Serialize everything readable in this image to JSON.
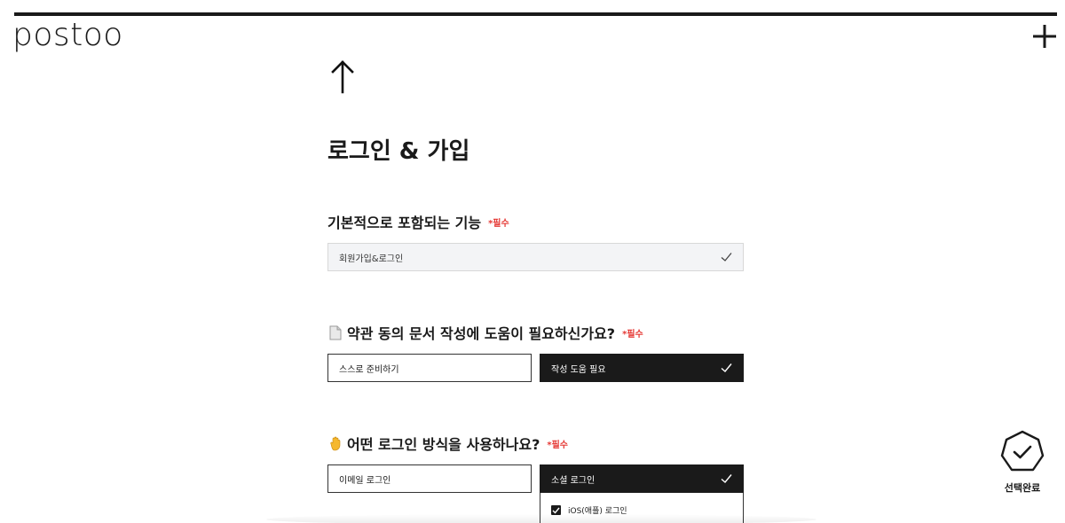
{
  "header": {
    "logo_text": "postoo",
    "plus_icon": "plus-icon"
  },
  "page": {
    "back_icon": "arrow-up-icon",
    "title": "로그인 & 가입"
  },
  "required_label": "*필수",
  "questions": [
    {
      "title": "기본적으로 포함되는 기능",
      "required": "*필수",
      "fixed_value": "회원가입&로그인"
    },
    {
      "icon": "document-icon",
      "title": "약관 동의 문서 작성에 도움이 필요하신가요?",
      "required": "*필수",
      "options": [
        {
          "label": "스스로 준비하기",
          "selected": false
        },
        {
          "label": "작성 도움 필요",
          "selected": true
        }
      ]
    },
    {
      "icon": "waving-hand-icon",
      "title": "어떤 로그인 방식을 사용하나요?",
      "required": "*필수",
      "options": [
        {
          "label": "이메일 로그인",
          "selected": false
        },
        {
          "label": "소셜 로그인",
          "selected": true
        }
      ],
      "sub_options": [
        {
          "label": "iOS(애플) 로그인",
          "checked": true
        }
      ]
    }
  ],
  "complete": {
    "label": "선택완료",
    "icon": "check-octagon-icon"
  },
  "colors": {
    "dark": "#1a1a1a",
    "required": "#e53935",
    "disabled_bg": "#f3f4f6",
    "accent_hand": "#f5b82e"
  }
}
